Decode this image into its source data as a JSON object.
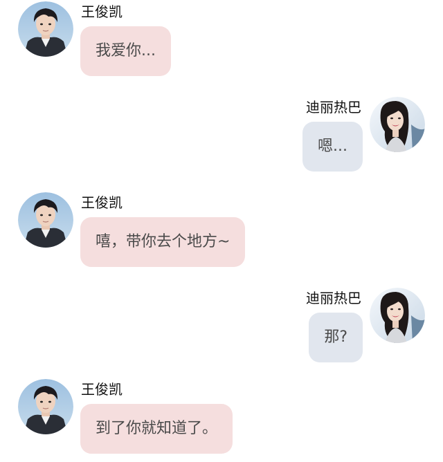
{
  "messages": [
    {
      "sender": "王俊凯",
      "side": "left",
      "text": "我爱你...",
      "avatar_icon": "wang-junkai-avatar"
    },
    {
      "sender": "迪丽热巴",
      "side": "right",
      "text": "嗯...",
      "avatar_icon": "dilireba-avatar"
    },
    {
      "sender": "王俊凯",
      "side": "left",
      "text": "嘻，带你去个地方~",
      "avatar_icon": "wang-junkai-avatar"
    },
    {
      "sender": "迪丽热巴",
      "side": "right",
      "text": "那?",
      "avatar_icon": "dilireba-avatar"
    },
    {
      "sender": "王俊凯",
      "side": "left",
      "text": "到了你就知道了。",
      "avatar_icon": "wang-junkai-avatar"
    }
  ],
  "colors": {
    "left_bubble": "#f5dede",
    "right_bubble": "#e1e6ee",
    "text": "#4a4a4a",
    "name": "#111111"
  }
}
